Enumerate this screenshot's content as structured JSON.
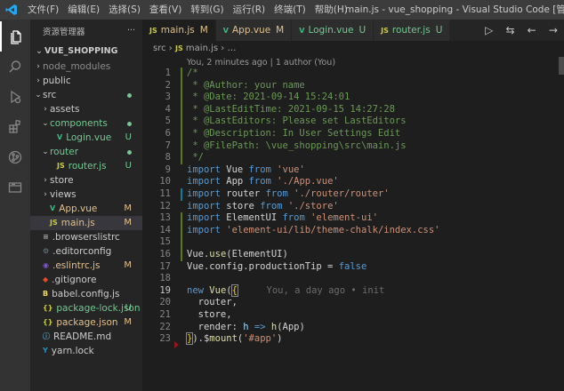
{
  "titlebar": {
    "menus": [
      "文件(F)",
      "编辑(E)",
      "选择(S)",
      "查看(V)",
      "转到(G)",
      "运行(R)",
      "终端(T)",
      "帮助(H)"
    ],
    "title": "main.js - vue_shopping - Visual Studio Code [管理员]"
  },
  "activity": [
    {
      "name": "explorer-icon",
      "glyph": "files"
    },
    {
      "name": "search-icon",
      "glyph": "search"
    },
    {
      "name": "run-debug-icon",
      "glyph": "debug"
    },
    {
      "name": "extensions-icon",
      "glyph": "extensions"
    },
    {
      "name": "source-control-icon",
      "glyph": "git"
    },
    {
      "name": "remote-explorer-icon",
      "glyph": "folder"
    }
  ],
  "sidebar": {
    "header": "资源管理器",
    "more": "···",
    "project": "VUE_SHOPPING",
    "items": [
      {
        "label": "node_modules",
        "depth": 1,
        "chev": "›",
        "color": "grey",
        "icon": "",
        "status": ""
      },
      {
        "label": "public",
        "depth": 1,
        "chev": "›",
        "color": "def",
        "icon": "",
        "status": ""
      },
      {
        "label": "src",
        "depth": 1,
        "chev": "⌄",
        "color": "def",
        "icon": "",
        "status": "dot"
      },
      {
        "label": "assets",
        "depth": 2,
        "chev": "›",
        "color": "def",
        "icon": "",
        "status": ""
      },
      {
        "label": "components",
        "depth": 2,
        "chev": "⌄",
        "color": "new",
        "icon": "",
        "status": "dot"
      },
      {
        "label": "Login.vue",
        "depth": 3,
        "chev": "",
        "color": "new",
        "icon": "vue",
        "status": "U"
      },
      {
        "label": "router",
        "depth": 2,
        "chev": "⌄",
        "color": "new",
        "icon": "",
        "status": "dot"
      },
      {
        "label": "router.js",
        "depth": 3,
        "chev": "",
        "color": "new",
        "icon": "js",
        "status": "U"
      },
      {
        "label": "store",
        "depth": 2,
        "chev": "›",
        "color": "def",
        "icon": "",
        "status": ""
      },
      {
        "label": "views",
        "depth": 2,
        "chev": "›",
        "color": "def",
        "icon": "",
        "status": ""
      },
      {
        "label": "App.vue",
        "depth": 2,
        "chev": "",
        "color": "mod",
        "icon": "vue",
        "status": "M"
      },
      {
        "label": "main.js",
        "depth": 2,
        "chev": "",
        "color": "mod",
        "icon": "js",
        "status": "M",
        "selected": true
      },
      {
        "label": ".browserslistrc",
        "depth": 1,
        "chev": "",
        "color": "def",
        "icon": "browserslist",
        "status": ""
      },
      {
        "label": ".editorconfig",
        "depth": 1,
        "chev": "",
        "color": "def",
        "icon": "gear",
        "status": ""
      },
      {
        "label": ".eslintrc.js",
        "depth": 1,
        "chev": "",
        "color": "mod",
        "icon": "eslint",
        "status": "M"
      },
      {
        "label": ".gitignore",
        "depth": 1,
        "chev": "",
        "color": "def",
        "icon": "git",
        "status": ""
      },
      {
        "label": "babel.config.js",
        "depth": 1,
        "chev": "",
        "color": "def",
        "icon": "babel",
        "status": ""
      },
      {
        "label": "package-lock.json",
        "depth": 1,
        "chev": "",
        "color": "new",
        "icon": "json",
        "status": "U"
      },
      {
        "label": "package.json",
        "depth": 1,
        "chev": "",
        "color": "mod",
        "icon": "json",
        "status": "M"
      },
      {
        "label": "README.md",
        "depth": 1,
        "chev": "",
        "color": "def",
        "icon": "info",
        "status": ""
      },
      {
        "label": "yarn.lock",
        "depth": 1,
        "chev": "",
        "color": "def",
        "icon": "yarn",
        "status": ""
      }
    ]
  },
  "tabs": [
    {
      "label": "main.js",
      "icon": "js",
      "status": "M",
      "color": "mod",
      "active": true
    },
    {
      "label": "App.vue",
      "icon": "vue",
      "status": "M",
      "color": "mod"
    },
    {
      "label": "Login.vue",
      "icon": "vue",
      "status": "U",
      "color": "new"
    },
    {
      "label": "router.js",
      "icon": "js",
      "status": "U",
      "color": "new"
    }
  ],
  "breadcrumb": {
    "folder": "src",
    "sep": "›",
    "file": "main.js",
    "tail": "…"
  },
  "blame": "You, 2 minutes ago | 1 author (You)",
  "inline_blame": "You, a day ago • init",
  "code": [
    {
      "n": 1,
      "g": "add",
      "t": [
        [
          "com",
          "/*"
        ]
      ]
    },
    {
      "n": 2,
      "g": "add",
      "t": [
        [
          "com",
          " * @Author: your name"
        ]
      ]
    },
    {
      "n": 3,
      "g": "add",
      "t": [
        [
          "com",
          " * @Date: 2021-09-14 15:24:01"
        ]
      ]
    },
    {
      "n": 4,
      "g": "add",
      "t": [
        [
          "com",
          " * @LastEditTime: 2021-09-15 14:27:28"
        ]
      ]
    },
    {
      "n": 5,
      "g": "add",
      "t": [
        [
          "com",
          " * @LastEditors: Please set LastEditors"
        ]
      ]
    },
    {
      "n": 6,
      "g": "add",
      "t": [
        [
          "com",
          " * @Description: In User Settings Edit"
        ]
      ]
    },
    {
      "n": 7,
      "g": "add",
      "t": [
        [
          "com",
          " * @FilePath: \\vue_shopping\\src\\main.js"
        ]
      ]
    },
    {
      "n": 8,
      "g": "add",
      "t": [
        [
          "com",
          " */"
        ]
      ]
    },
    {
      "n": 9,
      "g": "",
      "t": [
        [
          "kw",
          "import"
        ],
        [
          "id",
          " Vue "
        ],
        [
          "kw",
          "from"
        ],
        [
          "id",
          " "
        ],
        [
          "str",
          "'vue'"
        ]
      ]
    },
    {
      "n": 10,
      "g": "",
      "t": [
        [
          "kw",
          "import"
        ],
        [
          "id",
          " App "
        ],
        [
          "kw",
          "from"
        ],
        [
          "id",
          " "
        ],
        [
          "str",
          "'./App.vue'"
        ]
      ]
    },
    {
      "n": 11,
      "g": "mod",
      "t": [
        [
          "kw",
          "import"
        ],
        [
          "id",
          " router "
        ],
        [
          "kw",
          "from"
        ],
        [
          "id",
          " "
        ],
        [
          "str",
          "'./router/router'"
        ]
      ]
    },
    {
      "n": 12,
      "g": "",
      "t": [
        [
          "kw",
          "import"
        ],
        [
          "id",
          " store "
        ],
        [
          "kw",
          "from"
        ],
        [
          "id",
          " "
        ],
        [
          "str",
          "'./store'"
        ]
      ]
    },
    {
      "n": 13,
      "g": "add",
      "t": [
        [
          "kw",
          "import"
        ],
        [
          "id",
          " ElementUI "
        ],
        [
          "kw",
          "from"
        ],
        [
          "id",
          " "
        ],
        [
          "str",
          "'element-ui'"
        ]
      ]
    },
    {
      "n": 14,
      "g": "add",
      "t": [
        [
          "kw",
          "import"
        ],
        [
          "id",
          " "
        ],
        [
          "str",
          "'element-ui/lib/theme-chalk/index.css'"
        ]
      ]
    },
    {
      "n": 15,
      "g": "add",
      "t": []
    },
    {
      "n": 16,
      "g": "add",
      "t": [
        [
          "id",
          "Vue."
        ],
        [
          "fn",
          "use"
        ],
        [
          "id",
          "(ElementUI)"
        ]
      ]
    },
    {
      "n": 17,
      "g": "",
      "t": [
        [
          "id",
          "Vue.config.productionTip = "
        ],
        [
          "kw",
          "false"
        ]
      ]
    },
    {
      "n": 18,
      "g": "",
      "t": []
    },
    {
      "n": 19,
      "g": "",
      "cur": true,
      "t": [
        [
          "kw",
          "new"
        ],
        [
          "id",
          " "
        ],
        [
          "fn",
          "Vue"
        ],
        [
          "id",
          "("
        ],
        [
          "brk",
          "{"
        ],
        [
          "cursor",
          ""
        ],
        [
          "ghost",
          "     You, a day ago • init"
        ]
      ]
    },
    {
      "n": 20,
      "g": "",
      "t": [
        [
          "id",
          "  router,"
        ]
      ]
    },
    {
      "n": 21,
      "g": "",
      "t": [
        [
          "id",
          "  store,"
        ]
      ]
    },
    {
      "n": 22,
      "g": "",
      "t": [
        [
          "id",
          "  render: "
        ],
        [
          "var",
          "h"
        ],
        [
          "id",
          " "
        ],
        [
          "kw",
          "=>"
        ],
        [
          "id",
          " "
        ],
        [
          "fn",
          "h"
        ],
        [
          "id",
          "(App)"
        ]
      ]
    },
    {
      "n": 23,
      "g": "del",
      "t": [
        [
          "brk",
          "}"
        ],
        [
          "id",
          ").$"
        ],
        [
          "fn",
          "mount"
        ],
        [
          "id",
          "("
        ],
        [
          "str",
          "'#app'"
        ],
        [
          "id",
          ")"
        ]
      ]
    }
  ],
  "colors": {
    "added": "#587c0c",
    "modified": "#0c7d9d",
    "deleted": "#94151b",
    "accent": "#007acc"
  }
}
